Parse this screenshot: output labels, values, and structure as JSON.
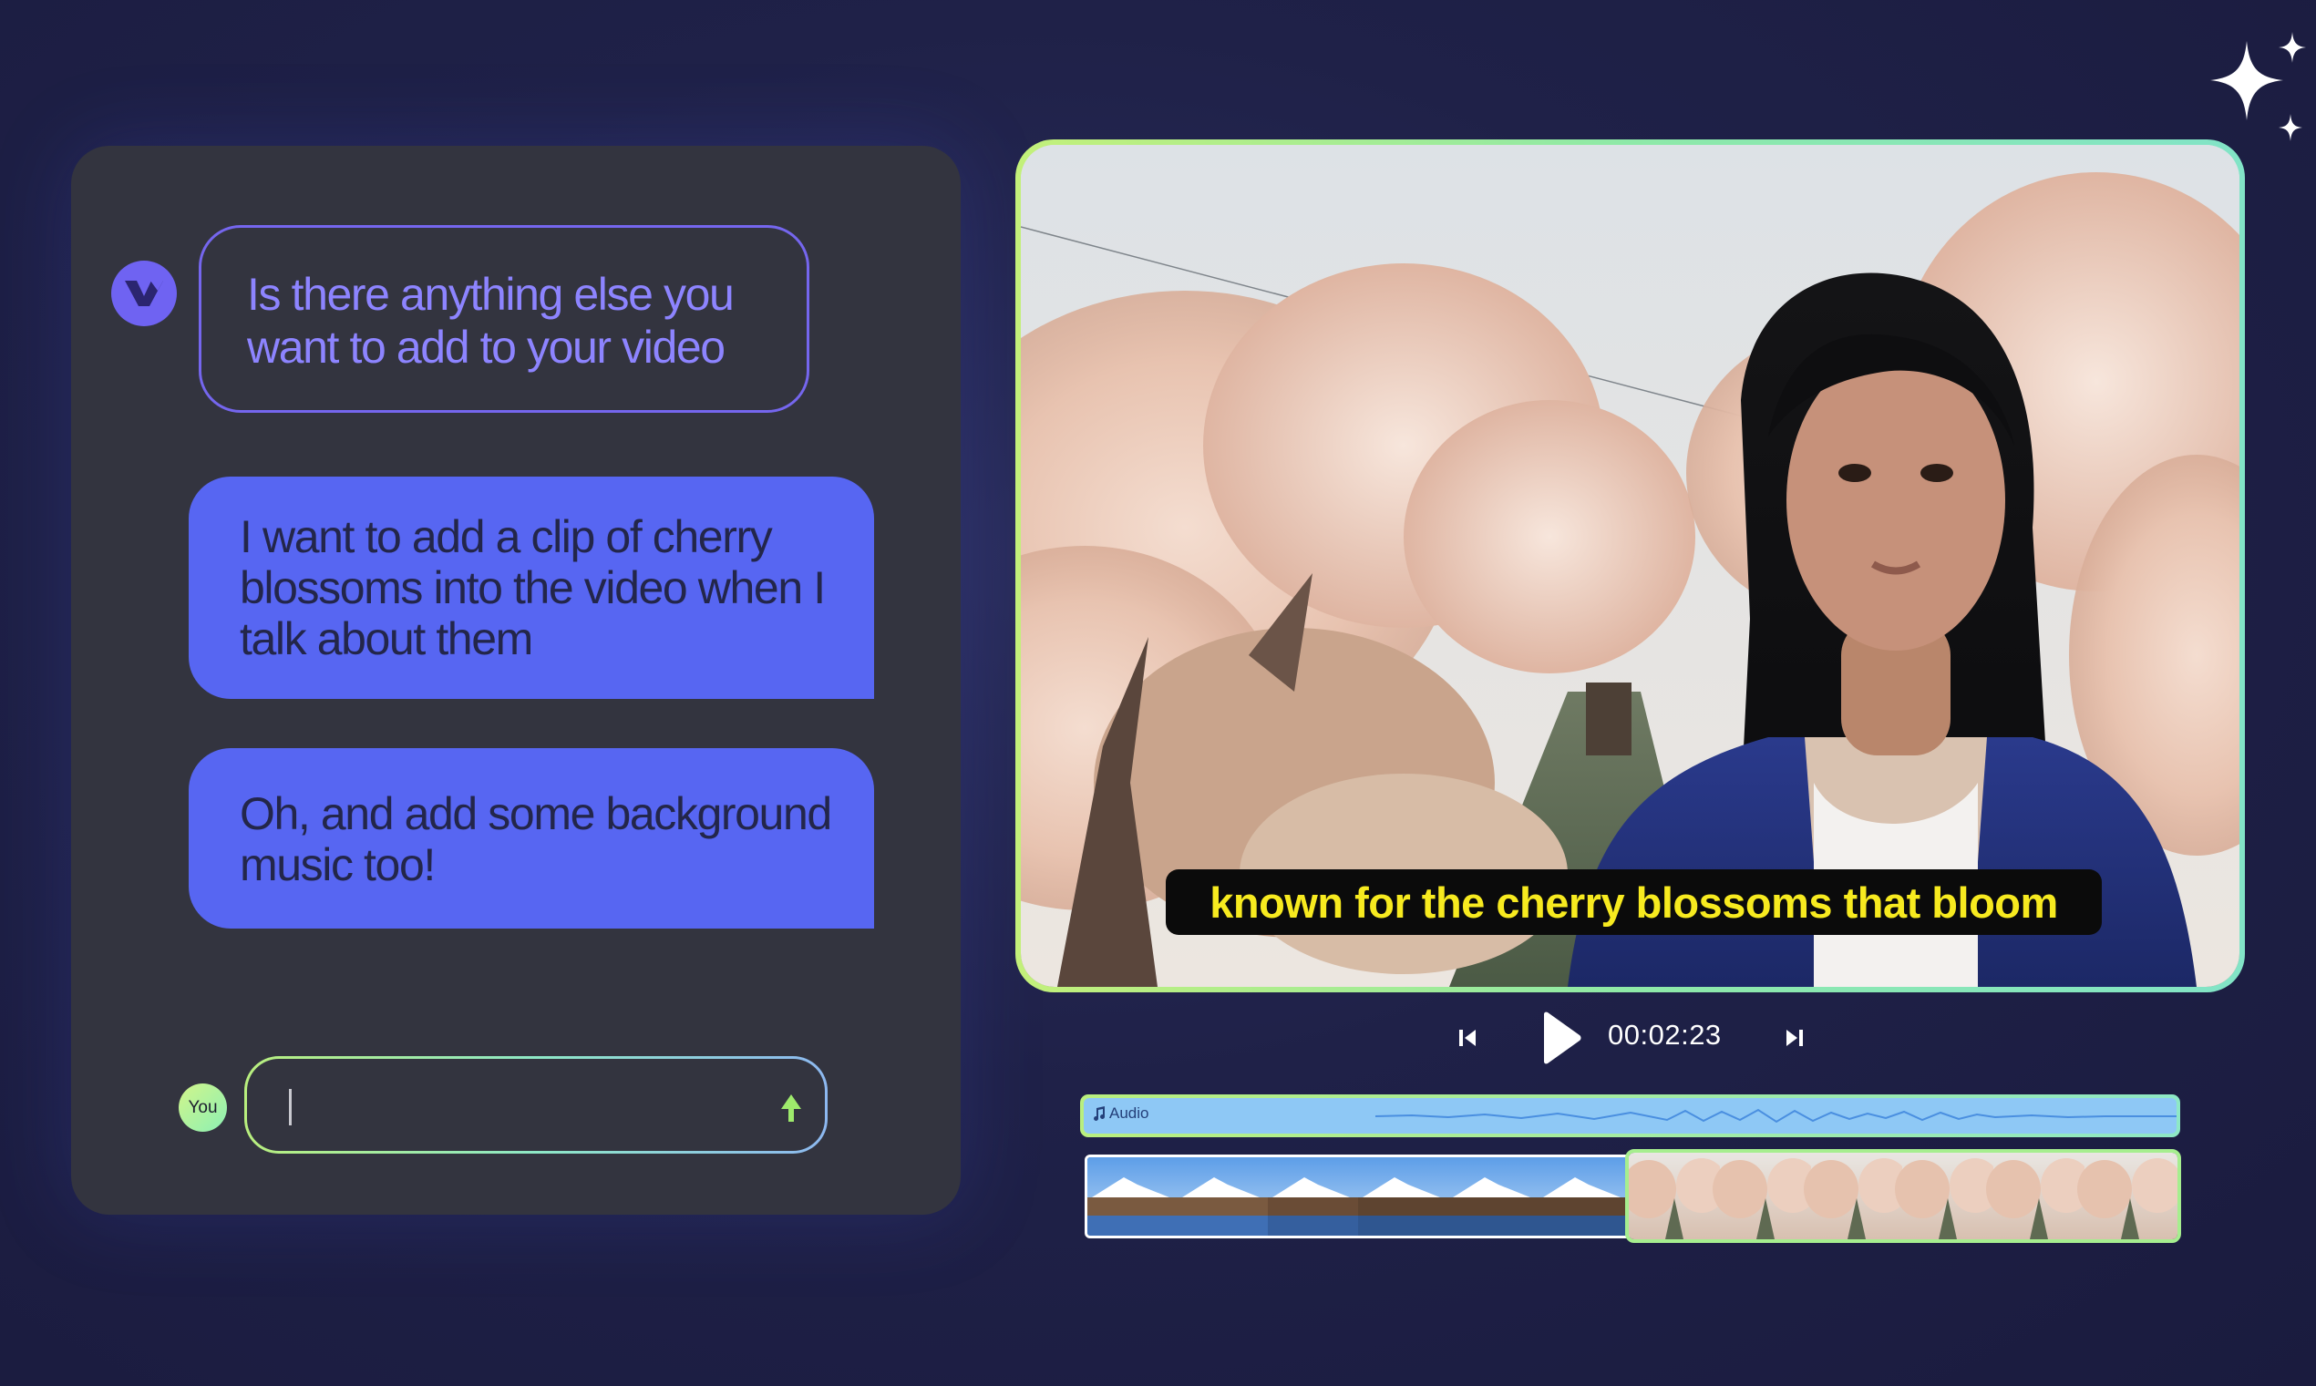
{
  "chat": {
    "assistant_avatar": "vidyo-logo-icon",
    "messages": [
      {
        "role": "assistant",
        "text": "Is there anything else you want to add to your video"
      },
      {
        "role": "user",
        "text": "I want to add a clip of cherry blossoms into the video when I talk about them"
      },
      {
        "role": "user",
        "text": "Oh, and add some background music too!"
      }
    ],
    "you_label": "You",
    "input_value": "",
    "send_icon": "arrow-up-icon"
  },
  "video": {
    "caption": "known for the cherry blossoms that bloom"
  },
  "player": {
    "prev_icon": "skip-previous-icon",
    "play_icon": "play-icon",
    "timecode": "00:02:23",
    "next_icon": "skip-next-icon"
  },
  "timeline": {
    "audio_label": "Audio",
    "audio_icon": "music-note-icon",
    "clips": [
      {
        "name": "mountains-clip",
        "frames": 6
      },
      {
        "name": "cherry-blossoms-clip",
        "frames": 6
      }
    ]
  },
  "colors": {
    "background": "#1f2148",
    "panel": "#33343f",
    "accent_purple": "#5766f2",
    "accent_green": "#b9ef7e",
    "caption_text": "#f7ea1f"
  }
}
